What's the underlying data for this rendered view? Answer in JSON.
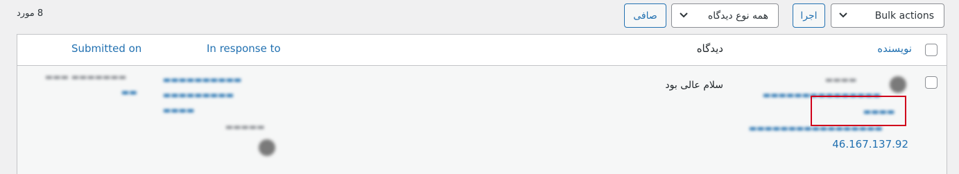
{
  "toolbar": {
    "count": "8 مورد",
    "bulk_actions": "Bulk actions",
    "apply": "اجرا",
    "comment_type_filter": "همه نوع دیدگاه",
    "filter_button": "صافی"
  },
  "table": {
    "headers": {
      "author": "نویسنده",
      "comment": "دیدگاه",
      "in_response_to": "In response to",
      "submitted_on": "Submitted on"
    },
    "row": {
      "comment": "سلام عالی بود",
      "author_ip": "46.167.137.92"
    }
  },
  "colors": {
    "link": "#2271b1",
    "highlight": "#d0021b",
    "border": "#c3c4c7"
  },
  "icons": [
    "chevron-down-icon",
    "checkbox",
    "avatar"
  ]
}
